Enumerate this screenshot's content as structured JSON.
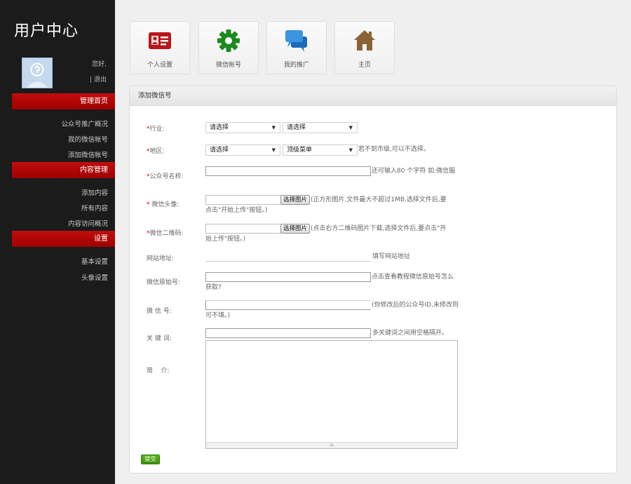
{
  "sidebar": {
    "title": "用户中心",
    "greeting": "您好,",
    "logout": "| 退出",
    "sections": [
      {
        "label": "管理首页",
        "items": [
          "公众号推广概况",
          "我的微信帐号",
          "添加微信帐号"
        ]
      },
      {
        "label": "内容管理",
        "items": [
          "添加内容",
          "所有内容",
          "内容访问概况"
        ]
      },
      {
        "label": "设置",
        "items": [
          "基本设置",
          "头像设置"
        ]
      }
    ]
  },
  "tiles": [
    {
      "label": "个人设置",
      "icon": "id-card-icon",
      "color": "#b8161b"
    },
    {
      "label": "微信帐号",
      "icon": "gear-icon",
      "color": "#1e8a1e"
    },
    {
      "label": "我的推广",
      "icon": "chat-bubble-icon",
      "color": "#2d7fd3"
    },
    {
      "label": "主页",
      "icon": "home-icon",
      "color": "#8b6235"
    }
  ],
  "form": {
    "title": "添加微信号",
    "required_mark": "*",
    "industry": {
      "label": "行业:",
      "select1": "请选择",
      "select2": "请选择"
    },
    "region": {
      "label": "地区:",
      "select1": "请选择",
      "select2": "顶级菜单",
      "hint": "若不到市级,可以不选择。"
    },
    "account_name": {
      "label": "公众号名称:",
      "hint": "还可输入80 个字符 如:微信服"
    },
    "avatar": {
      "label": " 微信头像:",
      "button": "选择图片",
      "hint": "(正方形图片,文件最大不超过1MB,选择文件后,要点击\"开始上传\"按钮。)"
    },
    "qrcode": {
      "label": "微信二维码:",
      "button": "选择图片",
      "hint": "(点击右方二维码图片下载,选择文件后,要点击\"开始上传\"按钮。)"
    },
    "website": {
      "label": "网站地址:",
      "hint": "填写网站地址"
    },
    "original_id": {
      "label": "微信原始号:",
      "hint": "点击查看教程微信原始号怎么获取?"
    },
    "wechat_id": {
      "label": "微 信 号:",
      "hint": "(你修改后的公众号ID,未修改则可不填。)"
    },
    "keywords": {
      "label": "关 键 词:",
      "hint": "多关键词之间用空格隔开。"
    },
    "intro": {
      "label": "简    介:"
    },
    "submit": "提交"
  }
}
